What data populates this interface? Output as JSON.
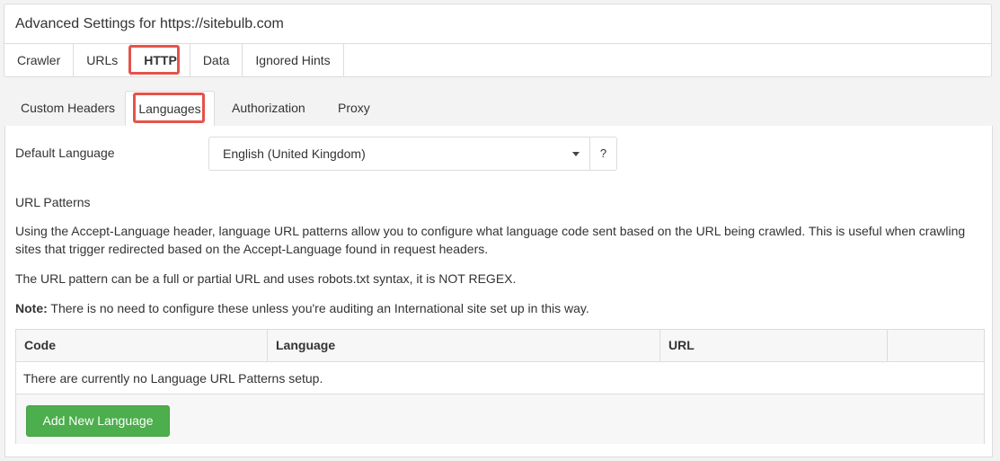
{
  "header": {
    "title": "Advanced Settings for https://sitebulb.com"
  },
  "main_tabs": [
    {
      "label": "Crawler"
    },
    {
      "label": "URLs"
    },
    {
      "label": "HTTP",
      "active": true
    },
    {
      "label": "Data"
    },
    {
      "label": "Ignored Hints"
    }
  ],
  "sub_tabs": [
    {
      "label": "Custom Headers"
    },
    {
      "label": "Languages",
      "active": true
    },
    {
      "label": "Authorization"
    },
    {
      "label": "Proxy"
    }
  ],
  "default_language": {
    "label": "Default Language",
    "value": "English (United Kingdom)",
    "help": "?"
  },
  "url_patterns": {
    "title": "URL Patterns",
    "desc1": "Using the Accept-Language header, language URL patterns allow you to configure what language code sent based on the URL being crawled. This is useful when crawling sites that trigger redirected based on the Accept-Language found in request headers.",
    "desc2": "The URL pattern can be a full or partial URL and uses robots.txt syntax, it is NOT REGEX.",
    "note_label": "Note:",
    "note_text": " There is no need to configure these unless you're auditing an International site set up in this way."
  },
  "table": {
    "columns": [
      "Code",
      "Language",
      "URL",
      ""
    ],
    "empty_message": "There are currently no Language URL Patterns setup.",
    "add_button": "Add New Language"
  },
  "colors": {
    "highlight": "#e5534b",
    "success": "#4cae4c"
  }
}
